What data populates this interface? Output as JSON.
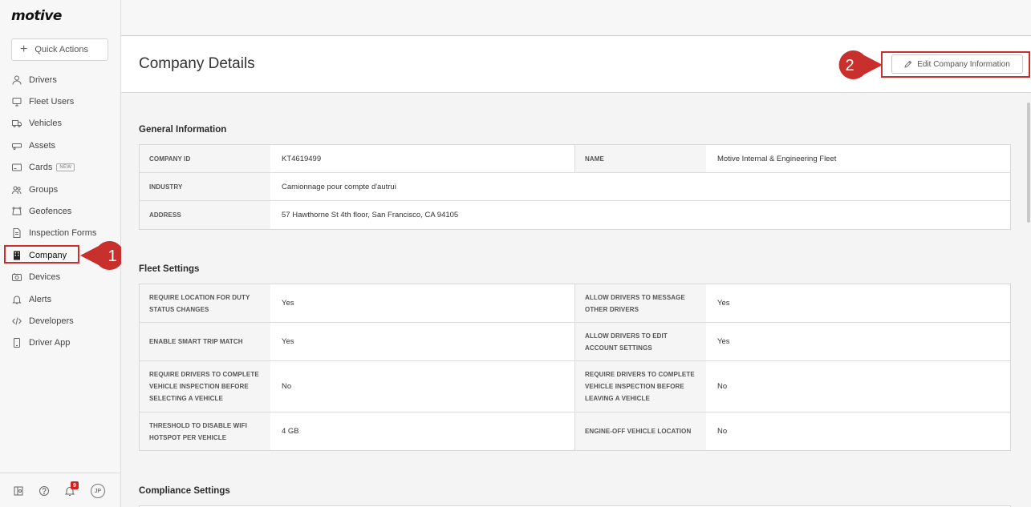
{
  "brand": {
    "logo_text": "motive",
    "accent": "#c8302e"
  },
  "quick_actions": {
    "label": "Quick Actions"
  },
  "nav": {
    "items": [
      {
        "label": "Drivers",
        "icon": "person-icon"
      },
      {
        "label": "Fleet Users",
        "icon": "monitor-icon"
      },
      {
        "label": "Vehicles",
        "icon": "truck-icon"
      },
      {
        "label": "Assets",
        "icon": "trailer-icon"
      },
      {
        "label": "Cards",
        "icon": "card-icon",
        "badge": "NEW"
      },
      {
        "label": "Groups",
        "icon": "groups-icon"
      },
      {
        "label": "Geofences",
        "icon": "geofence-icon"
      },
      {
        "label": "Inspection Forms",
        "icon": "document-icon"
      },
      {
        "label": "Company",
        "icon": "building-icon",
        "active": true
      },
      {
        "label": "Devices",
        "icon": "device-icon"
      },
      {
        "label": "Alerts",
        "icon": "bell-icon"
      },
      {
        "label": "Developers",
        "icon": "code-icon"
      },
      {
        "label": "Driver App",
        "icon": "phone-icon"
      }
    ]
  },
  "sidebar_bottom": {
    "notification_count": "9",
    "avatar_initials": "JP"
  },
  "annotations": {
    "step1": "1",
    "step2": "2"
  },
  "page": {
    "title": "Company Details",
    "edit_button": "Edit Company Information"
  },
  "general": {
    "title": "General Information",
    "company_id_label": "COMPANY ID",
    "company_id_value": "KT4619499",
    "name_label": "NAME",
    "name_value": "Motive Internal & Engineering Fleet",
    "industry_label": "INDUSTRY",
    "industry_value": "Camionnage pour compte d'autrui",
    "address_label": "ADDRESS",
    "address_value": "57 Hawthorne St 4th floor, San Francisco, CA 94105"
  },
  "fleet": {
    "title": "Fleet Settings",
    "rows": [
      {
        "l1": "REQUIRE LOCATION FOR DUTY STATUS CHANGES",
        "v1": "Yes",
        "l2": "ALLOW DRIVERS TO MESSAGE OTHER DRIVERS",
        "v2": "Yes"
      },
      {
        "l1": "ENABLE SMART TRIP MATCH",
        "v1": "Yes",
        "l2": "ALLOW DRIVERS TO EDIT ACCOUNT SETTINGS",
        "v2": "Yes"
      },
      {
        "l1": "REQUIRE DRIVERS TO COMPLETE VEHICLE INSPECTION BEFORE SELECTING A VEHICLE",
        "v1": "No",
        "l2": "REQUIRE DRIVERS TO COMPLETE VEHICLE INSPECTION BEFORE LEAVING A VEHICLE",
        "v2": "No"
      },
      {
        "l1": "THRESHOLD TO DISABLE WIFI HOTSPOT PER VEHICLE",
        "v1": "4 GB",
        "l2": "ENGINE-OFF VEHICLE LOCATION",
        "v2": "No"
      }
    ]
  },
  "compliance": {
    "title": "Compliance Settings"
  }
}
